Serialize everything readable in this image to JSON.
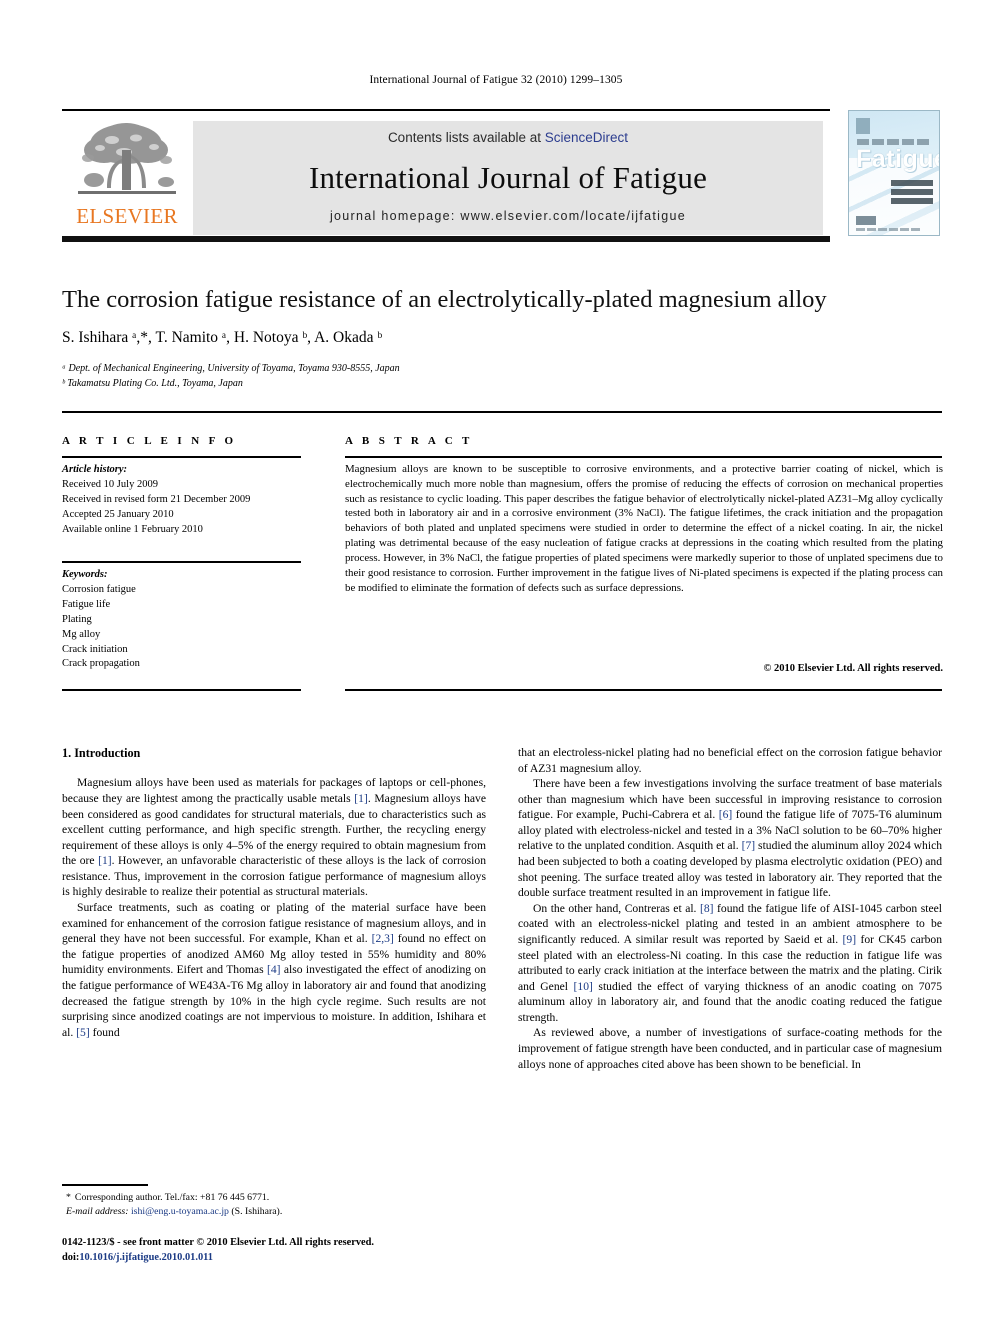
{
  "running_head": "International Journal of Fatigue 32 (2010) 1299–1305",
  "masthead": {
    "contents_prefix": "Contents lists available at ",
    "sciencedirect": "ScienceDirect",
    "journal_title": "International Journal of Fatigue",
    "homepage": "journal homepage: www.elsevier.com/locate/ijfatigue",
    "publisher_logo_text": "ELSEVIER",
    "cover_wordmark": "Fatigue",
    "accent_orange": "#e87722",
    "link_blue": "#2c3d8f",
    "band_gray": "#e4e4e4",
    "cover_blue": "#cfe6f2"
  },
  "article": {
    "title": "The corrosion fatigue resistance of an electrolytically-plated magnesium alloy",
    "authors": "S. Ishihara ᵃ,*, T. Namito ᵃ, H. Notoya ᵇ, A. Okada ᵇ",
    "affiliation_a": "ᵃ Dept. of Mechanical Engineering, University of Toyama, Toyama 930-8555, Japan",
    "affiliation_b": "ᵇ Takamatsu Plating Co. Ltd., Toyama, Japan"
  },
  "info": {
    "heading": "A R T I C L E    I N F O",
    "history_label": "Article history:",
    "history": [
      "Received 10 July 2009",
      "Received in revised form 21 December 2009",
      "Accepted 25 January 2010",
      "Available online 1 February 2010"
    ],
    "keywords_label": "Keywords:",
    "keywords": [
      "Corrosion fatigue",
      "Fatigue life",
      "Plating",
      "Mg alloy",
      "Crack initiation",
      "Crack propagation"
    ]
  },
  "abstract": {
    "heading": "A B S T R A C T",
    "text": "Magnesium alloys are known to be susceptible to corrosive environments, and a protective barrier coating of nickel, which is electrochemically much more noble than magnesium, offers the promise of reducing the effects of corrosion on mechanical properties such as resistance to cyclic loading. This paper describes the fatigue behavior of electrolytically nickel-plated AZ31–Mg alloy cyclically tested both in laboratory air and in a corrosive environment (3% NaCl). The fatigue lifetimes, the crack initiation and the propagation behaviors of both plated and unplated specimens were studied in order to determine the effect of a nickel coating. In air, the nickel plating was detrimental because of the easy nucleation of fatigue cracks at depressions in the coating which resulted from the plating process. However, in 3% NaCl, the fatigue properties of plated specimens were markedly superior to those of unplated specimens due to their good resistance to corrosion. Further improvement in the fatigue lives of Ni-plated specimens is expected if the plating process can be modified to eliminate the formation of defects such as surface depressions.",
    "copyright": "© 2010 Elsevier Ltd. All rights reserved."
  },
  "body": {
    "section_heading": "1. Introduction",
    "left_p1_a": "Magnesium alloys have been used as materials for packages of laptops or cell-phones, because they are lightest among the practically usable metals ",
    "left_p1_r1": "[1]",
    "left_p1_b": ". Magnesium alloys have been considered as good candidates for structural materials, due to characteristics such as excellent cutting performance, and high specific strength. Further, the recycling energy requirement of these alloys is only 4–5% of the energy required to obtain magnesium from the ore ",
    "left_p1_r2": "[1]",
    "left_p1_c": ". However, an unfavorable characteristic of these alloys is the lack of corrosion resistance. Thus, improvement in the corrosion fatigue performance of magnesium alloys is highly desirable to realize their potential as structural materials.",
    "left_p2_a": "Surface treatments, such as coating or plating of the material surface have been examined for enhancement of the corrosion fatigue resistance of magnesium alloys, and in general they have not been successful. For example, Khan et al. ",
    "left_p2_r1": "[2,3]",
    "left_p2_b": " found no effect on the fatigue properties of anodized AM60 Mg alloy tested in 55% humidity and 80% humidity environments. Eifert and Thomas ",
    "left_p2_r2": "[4]",
    "left_p2_c": " also investigated the effect of anodizing on the fatigue performance of WE43A-T6 Mg alloy in laboratory air and found that anodizing decreased the fatigue strength by 10% in the high cycle regime. Such results are not surprising since anodized coatings are not impervious to moisture. In addition, Ishihara et al. ",
    "left_p2_r3": "[5]",
    "left_p2_d": " found",
    "right_p1": "that an electroless-nickel plating had no beneficial effect on the corrosion fatigue behavior of AZ31 magnesium alloy.",
    "right_p2_a": "There have been a few investigations involving the surface treatment of base materials other than magnesium which have been successful in improving resistance to corrosion fatigue. For example, Puchi-Cabrera et al. ",
    "right_p2_r1": "[6]",
    "right_p2_b": " found the fatigue life of 7075-T6 aluminum alloy plated with electroless-nickel and tested in a 3% NaCl solution to be 60–70% higher relative to the unplated condition. Asquith et al. ",
    "right_p2_r2": "[7]",
    "right_p2_c": " studied the aluminum alloy 2024 which had been subjected to both a coating developed by plasma electrolytic oxidation (PEO) and shot peening. The surface treated alloy was tested in laboratory air. They reported that the double surface treatment resulted in an improvement in fatigue life.",
    "right_p3_a": "On the other hand, Contreras et al. ",
    "right_p3_r1": "[8]",
    "right_p3_b": " found the fatigue life of AISI-1045 carbon steel coated with an electroless-nickel plating and tested in an ambient atmosphere to be significantly reduced. A similar result was reported by Saeid et al. ",
    "right_p3_r2": "[9]",
    "right_p3_c": " for CK45 carbon steel plated with an electroless-Ni coating. In this case the reduction in fatigue life was attributed to early crack initiation at the interface between the matrix and the plating. Cirik and Genel ",
    "right_p3_r3": "[10]",
    "right_p3_d": " studied the effect of varying thickness of an anodic coating on 7075 aluminum alloy in laboratory air, and found that the anodic coating reduced the fatigue strength.",
    "right_p4": "As reviewed above, a number of investigations of surface-coating methods for the improvement of fatigue strength have been conducted, and in particular case of magnesium alloys none of approaches cited above has been shown to be beneficial. In"
  },
  "footer": {
    "star": "*",
    "corresponding": "Corresponding author. Tel./fax: +81 76 445 6771.",
    "email_label": "E-mail address:",
    "email": "ishi@eng.u-toyama.ac.jp",
    "email_suffix": "(S. Ishihara).",
    "issn_line": "0142-1123/$ - see front matter © 2010 Elsevier Ltd. All rights reserved.",
    "doi_label": "doi:",
    "doi": "10.1016/j.ijfatigue.2010.01.011"
  }
}
